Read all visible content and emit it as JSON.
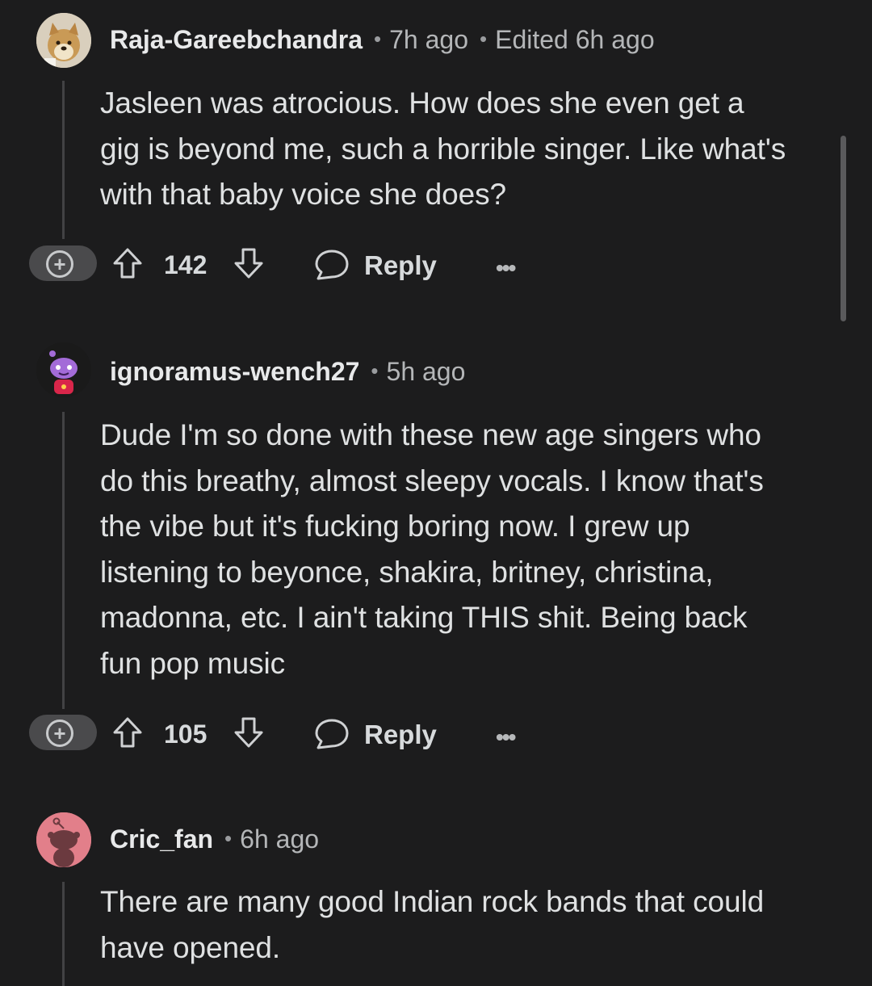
{
  "comments": [
    {
      "username": "Raja-Gareebchandra",
      "time": "7h ago",
      "edited": "Edited 6h ago",
      "avatar_icon": "doge-avatar-icon",
      "body": "Jasleen was atrocious. How does she even get a\ngig is beyond me, such a horrible singer. Like what's\nwith that baby voice she does?",
      "votes": "142",
      "reply_label": "Reply",
      "more_label": "•••"
    },
    {
      "username": "ignoramus-wench27",
      "time": "5h ago",
      "avatar_icon": "snoo-purple-avatar-icon",
      "body": "Dude I'm so done with these new age singers who\ndo this breathy, almost sleepy vocals. I know that's\nthe vibe but it's fucking boring now. I grew up\nlistening to beyonce, shakira, britney, christina,\nmadonna, etc. I ain't taking THIS shit. Being back\nfun pop music",
      "votes": "105",
      "reply_label": "Reply",
      "more_label": "•••"
    },
    {
      "username": "Cric_fan",
      "time": "6h ago",
      "avatar_icon": "snoo-pink-avatar-icon",
      "body": "There are many good Indian rock bands that could\nhave opened."
    }
  ],
  "expand_symbol": "+",
  "colors": {
    "background": "#1c1c1d",
    "text": "#d7dadc",
    "thread_line": "#424244",
    "pink_avatar": "#e27f8a",
    "purple_snoo": "#a36bd8"
  }
}
